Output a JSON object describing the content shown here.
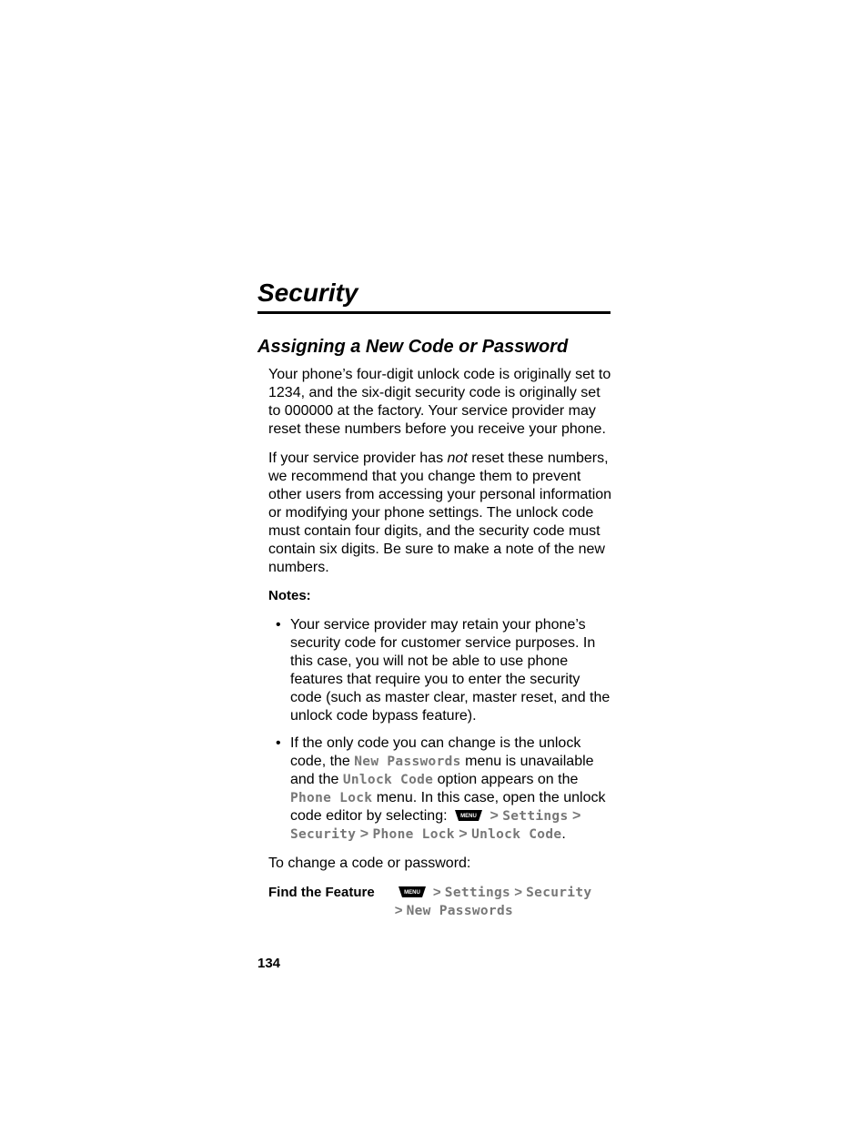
{
  "page_number": "134",
  "chapter_title": "Security",
  "section_title": "Assigning a New Code or Password",
  "para1": "Your phone’s four-digit unlock code is originally set to 1234, and the six-digit security code is originally set to 000000 at the factory. Your service provider may reset these numbers before you receive your phone.",
  "para2_a": "If your service provider has ",
  "para2_not": "not",
  "para2_b": " reset these numbers, we recommend that you change them to prevent other users from accessing your personal information or modifying your phone settings. The unlock code must contain four digits, and the security code must contain six digits. Be sure to make a note of the new numbers.",
  "notes_label": "Notes:",
  "note1": "Your service provider may retain your phone’s security code for customer service purposes. In this case, you will not be able to use phone features that require you to enter the security code (such as master clear, master reset, and the unlock code bypass feature).",
  "note2_a": "If the only code you can change is the unlock code, the ",
  "note2_new_passwords": "New Passwords",
  "note2_b": " menu is unavailable and the ",
  "note2_unlock_code": "Unlock Code",
  "note2_c": " option appears on the ",
  "note2_phone_lock": "Phone Lock",
  "note2_d": " menu. In this case, open the unlock code editor by selecting: ",
  "note2_path_settings": "Settings",
  "note2_path_security": "Security",
  "note2_path_phone_lock": "Phone Lock",
  "note2_path_unlock_code": "Unlock Code",
  "note2_period": ".",
  "change_line": "To change a code or password:",
  "find_label": "Find the Feature",
  "find_settings": "Settings",
  "find_security": "Security",
  "find_new_passwords": "New Passwords",
  "gt": ">",
  "menu_key_label": "MENU"
}
